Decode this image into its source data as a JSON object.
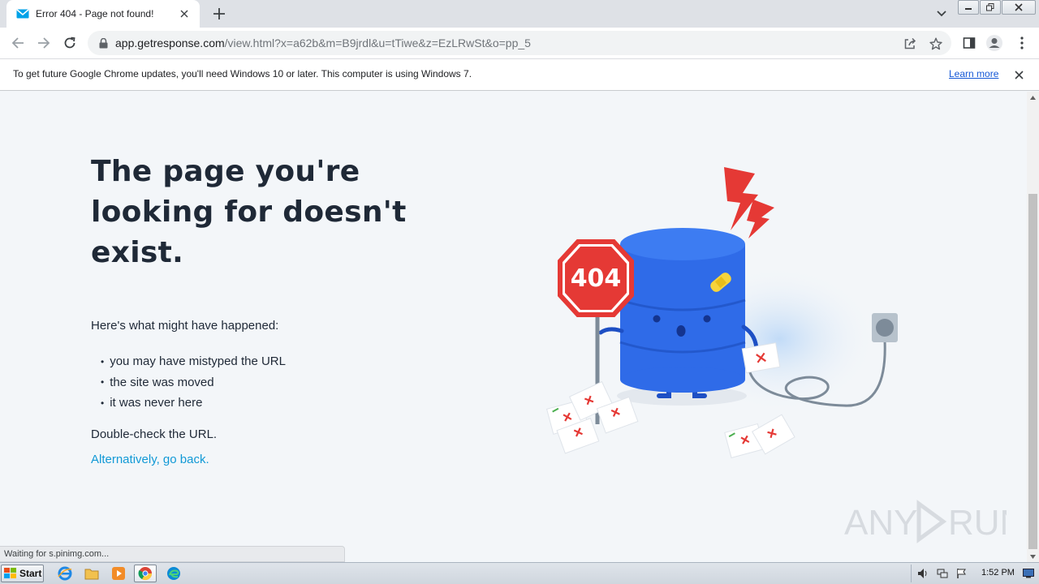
{
  "browser": {
    "tab": {
      "title": "Error 404 - Page not found!",
      "favicon": "envelope-icon"
    },
    "url": {
      "host": "app.getresponse.com",
      "rest": "/view.html?x=a62b&m=B9jrdl&u=tTiwe&z=EzLRwSt&o=pp_5"
    },
    "infobar": {
      "message": "To get future Google Chrome updates, you'll need Windows 10 or later. This computer is using Windows 7.",
      "link": "Learn more"
    },
    "status": "Waiting for s.pinimg.com..."
  },
  "page": {
    "heading": "The page you're looking for doesn't exist.",
    "intro": "Here's what might have happened:",
    "reasons": [
      "you may have mistyped the URL",
      "the site was moved",
      "it was never here"
    ],
    "check": "Double-check the URL.",
    "back_link": "Alternatively, go back.",
    "illustration": {
      "sign_text": "404"
    }
  },
  "watermark": {
    "text_left": "ANY",
    "text_right": "RUN"
  },
  "taskbar": {
    "start_label": "Start",
    "time": "1:52 PM"
  },
  "colors": {
    "accent": "#1199d6",
    "heading": "#1f2937",
    "database": "#2f6be8",
    "alert": "#e53935",
    "page_bg": "#f3f6f9"
  }
}
